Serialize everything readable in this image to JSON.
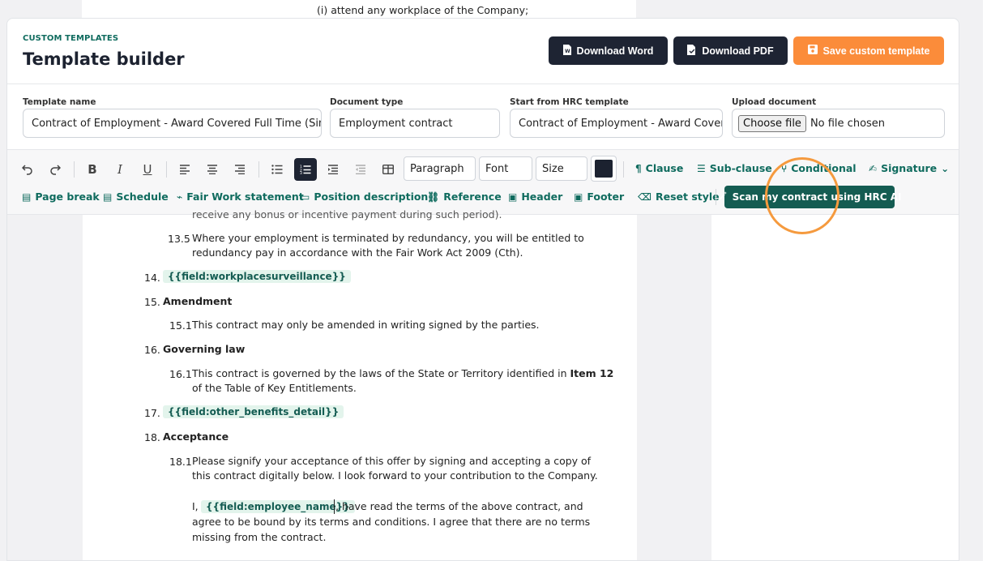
{
  "background": {
    "doc_line": "(i)  attend any workplace of the Company;"
  },
  "header": {
    "eyebrow": "CUSTOM TEMPLATES",
    "title": "Template builder",
    "download_word": "Download Word",
    "download_pdf": "Download PDF",
    "save_template": "Save custom template"
  },
  "fields": {
    "template_name_label": "Template name",
    "template_name_value": "Contract of Employment - Award Covered Full Time (Simple",
    "document_type_label": "Document type",
    "document_type_value": "Employment contract",
    "start_from_label": "Start from HRC template",
    "start_from_value": "Contract of Employment - Award Covere",
    "upload_label": "Upload document",
    "upload_button": "Choose file",
    "upload_status": "No file chosen"
  },
  "toolbar": {
    "paragraph": "Paragraph",
    "font": "Font",
    "size": "Size",
    "clause": "Clause",
    "sub_clause": "Sub-clause",
    "conditional": "Conditional",
    "signature": "Signature",
    "page_break": "Page break",
    "schedule": "Schedule",
    "fair_work": "Fair Work statement",
    "position_description": "Position description",
    "reference": "Reference",
    "header": "Header",
    "footer": "Footer",
    "reset_style": "Reset style",
    "scan": "Scan my contract using HRC AI"
  },
  "document": {
    "cut_line": "receive any bonus or incentive payment during such period).",
    "c13_5_num": "13.5",
    "c13_5_l1": "Where your employment is terminated by redundancy, you will be entitled to",
    "c13_5_l2": "redundancy pay in accordance with the Fair Work Act 2009 (Cth).",
    "c14_num": "14.",
    "c14_tag": "{{field:workplacesurveillance}}",
    "c15_num": "15.",
    "c15_title": "Amendment",
    "c15_1_num": "15.1",
    "c15_1_text": "This contract may only be amended in writing signed by the parties.",
    "c16_num": "16.",
    "c16_title": "Governing law",
    "c16_1_num": "16.1",
    "c16_1_l1a": "This contract is governed by the laws of the State or Territory identified in ",
    "c16_1_l1b": "Item 12",
    "c16_1_l2": "of the Table of Key Entitlements.",
    "c17_num": "17.",
    "c17_tag": "{{field:other_benefits_detail}}",
    "c18_num": "18.",
    "c18_title": "Acceptance",
    "c18_1_num": "18.1",
    "c18_1_l1": "Please signify your acceptance of this offer by signing and accepting a copy of",
    "c18_1_l2": "this contract digitally below.  I look forward to your contribution to the Company.",
    "ack_prefix": "I,",
    "ack_tag": "{{field:employee_name}}",
    "ack_l1": ", have read the terms of the above contract, and",
    "ack_l2": "agree to be bound by its terms and conditions. I agree that there are no terms",
    "ack_l3": "missing from the contract."
  },
  "colors": {
    "brand_teal": "#0f6b5e",
    "dark_button": "#1e2433",
    "orange_button": "#fb8c3a",
    "highlight_ring": "#f59a3e"
  }
}
